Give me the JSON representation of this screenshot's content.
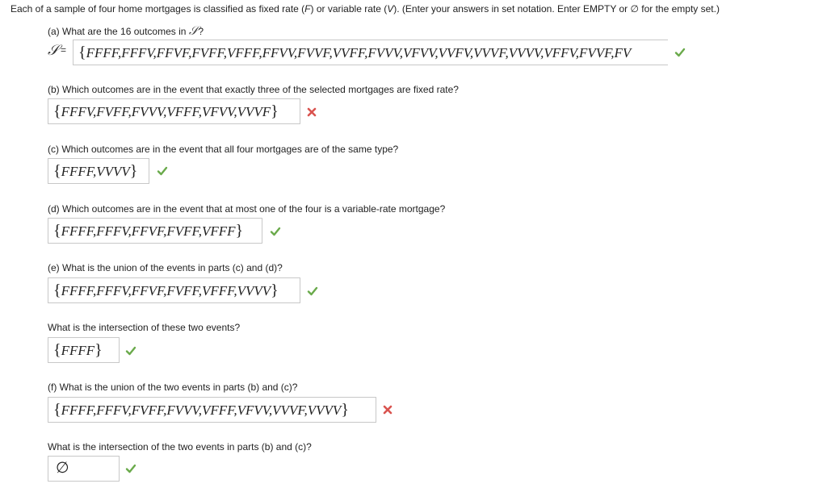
{
  "intro": {
    "part1": "Each of a sample of four home mortgages is classified as fixed rate (",
    "f": "F",
    "part2": ") or variable rate (",
    "v": "V",
    "part3": "). (Enter your answers in set notation. Enter EMPTY or ∅ for the empty set.)"
  },
  "questions": {
    "a": {
      "label": "(a) What are the 16 outcomes in ",
      "symbol": "𝒮",
      "suffix": "?",
      "answer_label": "𝒮",
      "answer_eq": "=",
      "answer": "FFFF,FFFV,FFVF,FVFF,VFFF,FFVV,FVVF,VVFF,FVVV,VFVV,VVFV,VVVF,VVVV,VFFV,FVVF,FV",
      "status": "correct"
    },
    "b": {
      "label": "(b) Which outcomes are in the event that exactly three of the selected mortgages are fixed rate?",
      "answer": "FFFV,FVFF,FVVV,VFFF,VFVV,VVVF",
      "status": "incorrect"
    },
    "c": {
      "label": "(c) Which outcomes are in the event that all four mortgages are of the same type?",
      "answer": "FFFF,VVVV",
      "status": "correct"
    },
    "d": {
      "label": "(d) Which outcomes are in the event that at most one of the four is a variable-rate mortgage?",
      "answer": "FFFF,FFFV,FFVF,FVFF,VFFF",
      "status": "correct"
    },
    "e": {
      "label": "(e) What is the union of the events in parts (c) and (d)?",
      "answer": "FFFF,FFFV,FFVF,FVFF,VFFF,VVVV",
      "status": "correct"
    },
    "e2": {
      "label": "What is the intersection of these two events?",
      "answer": "FFFF",
      "status": "correct"
    },
    "f": {
      "label": "(f) What is the union of the two events in parts (b) and (c)?",
      "answer": "FFFF,FFFV,FVFF,FVVV,VFFF,VFVV,VVVF,VVVV",
      "status": "incorrect"
    },
    "f2": {
      "label": "What is the intersection of the two events in parts (b) and (c)?",
      "answer": "∅",
      "status": "correct"
    }
  },
  "braces": {
    "open": "{",
    "close": "}"
  },
  "colors": {
    "correct": "#6aaa4b",
    "incorrect": "#d9534f"
  }
}
